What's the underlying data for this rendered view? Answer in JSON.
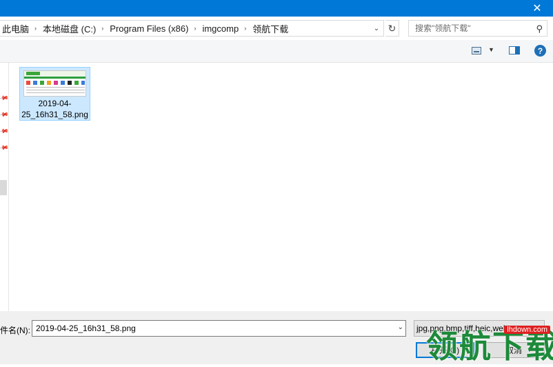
{
  "window": {
    "close_glyph": "✕"
  },
  "address": {
    "crumbs": [
      "此电脑",
      "本地磁盘 (C:)",
      "Program Files (x86)",
      "imgcomp",
      "领航下载"
    ],
    "separator": "›"
  },
  "search": {
    "placeholder": "搜索\"领航下载\""
  },
  "toolbar": {
    "help_label": "?"
  },
  "file": {
    "name": "2019-04-25_16h31_58.png"
  },
  "bottom": {
    "filename_label": "件名(N):",
    "filename_value": "2019-04-25_16h31_58.png",
    "filter_text": "jpg,png,bmp,tiff,heic,webp",
    "open_label": "打开(O)",
    "cancel_label": "取消"
  },
  "watermark": {
    "text": "领航下载",
    "url": "lhdown.com"
  },
  "colors": {
    "titlebar": "#0078d7",
    "selection": "#cce8ff",
    "watermark": "#1d8a3a"
  }
}
